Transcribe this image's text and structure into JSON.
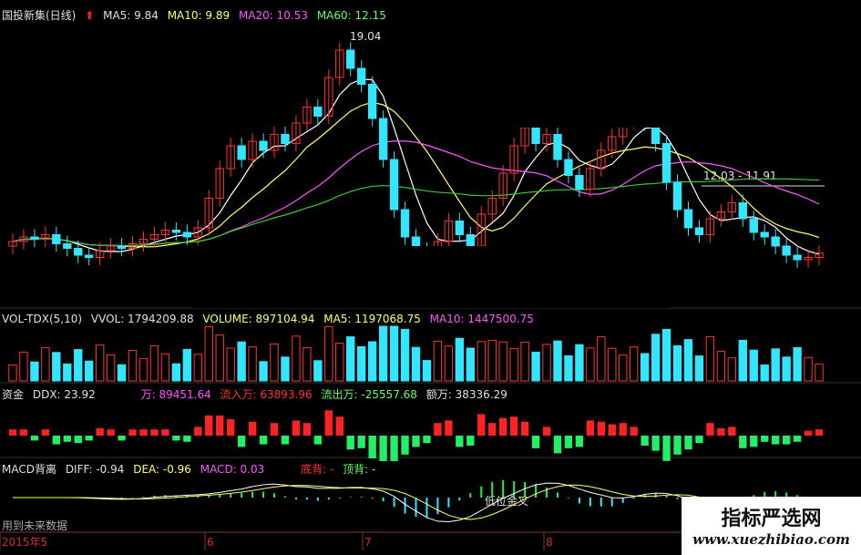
{
  "header": {
    "title": "国投新集(日线)",
    "ma5": "MA5: 9.84",
    "ma10": "MA10: 9.89",
    "ma20": "MA20: 10.53",
    "ma60": "MA60: 12.15"
  },
  "annotations": {
    "peak": "19.04",
    "range": "12.03 - 11.91"
  },
  "vol_header": {
    "name": "VOL-TDX(5,10)",
    "vvol": "VVOL: 1794209.88",
    "volume": "VOLUME: 897104.94",
    "ma5": "MA5: 1197068.75",
    "ma10": "MA10: 1447500.75"
  },
  "fund_header": {
    "name": "资金",
    "ddx": "DDX: 23.92",
    "wan": "万: 89451.64",
    "inflow": "流入万: 63893.96",
    "outflow": "流出万: -25557.68",
    "amount": "额万: 38336.29"
  },
  "macd_header": {
    "name": "MACD背离",
    "diff": "DIFF: -0.94",
    "dea": "DEA: -0.96",
    "macd": "MACD: 0.03",
    "bottom": "底背: -",
    "top": "顶背: -"
  },
  "macd_annotations": {
    "low_cross": "低位金叉",
    "future_data": "用到未来数据"
  },
  "xaxis": {
    "labels": [
      "2015年5",
      "6",
      "7",
      "8"
    ]
  },
  "watermark": {
    "title": "指标严选网",
    "url": "www.xuezhibiao.com"
  },
  "colors": {
    "up": "#ff3333",
    "down": "#33e6ff",
    "ma5": "#ffffff",
    "ma10": "#ffff66",
    "ma20": "#ff55ff",
    "ma60": "#33cc33"
  },
  "chart_data": {
    "type": "candlestick",
    "title": "国投新集(日线)",
    "ylabel": "",
    "peak_price": 19.04,
    "close_series": [
      10.6,
      10.8,
      10.7,
      10.9,
      10.5,
      10.3,
      10.0,
      9.9,
      10.2,
      10.4,
      10.3,
      10.5,
      10.7,
      10.9,
      11.1,
      11.0,
      10.8,
      11.2,
      12.5,
      13.8,
      14.8,
      14.2,
      15.0,
      14.6,
      15.3,
      14.9,
      15.8,
      16.5,
      16.1,
      17.8,
      19.0,
      18.2,
      17.5,
      16.0,
      14.2,
      12.0,
      10.8,
      10.2,
      9.9,
      10.6,
      11.5,
      10.9,
      10.4,
      11.8,
      12.5,
      13.6,
      14.8,
      15.6,
      14.9,
      15.3,
      14.2,
      13.5,
      12.9,
      13.8,
      14.6,
      15.2,
      15.9,
      16.3,
      15.8,
      14.9,
      13.2,
      12.0,
      11.2,
      10.9,
      11.6,
      11.9,
      12.3,
      11.6,
      11.0,
      10.8,
      10.4,
      10.0,
      9.8,
      9.9,
      10.1
    ],
    "ma5": "9.84",
    "ma10": "9.89",
    "ma20": "10.53",
    "ma60": "12.15"
  }
}
